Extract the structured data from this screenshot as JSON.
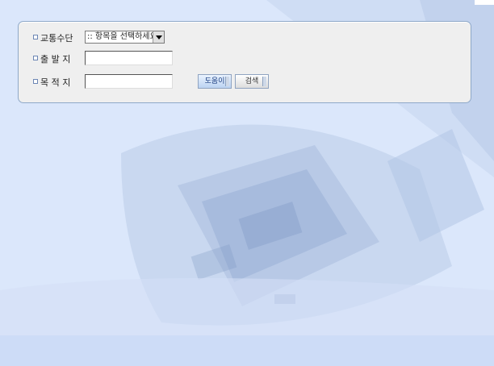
{
  "form": {
    "transport_label": "교통수단",
    "transport_selected": ":: 항목을 선택하세요",
    "origin_label": "출 발 지",
    "origin_value": "",
    "destination_label": "목 적 지",
    "destination_value": "",
    "help_button": "도움이",
    "search_button": "검색"
  },
  "colors": {
    "background": "#dbe7fb",
    "panel": "#efefef",
    "panel_border": "#8ea8c8",
    "accent": "#1d3f82"
  }
}
